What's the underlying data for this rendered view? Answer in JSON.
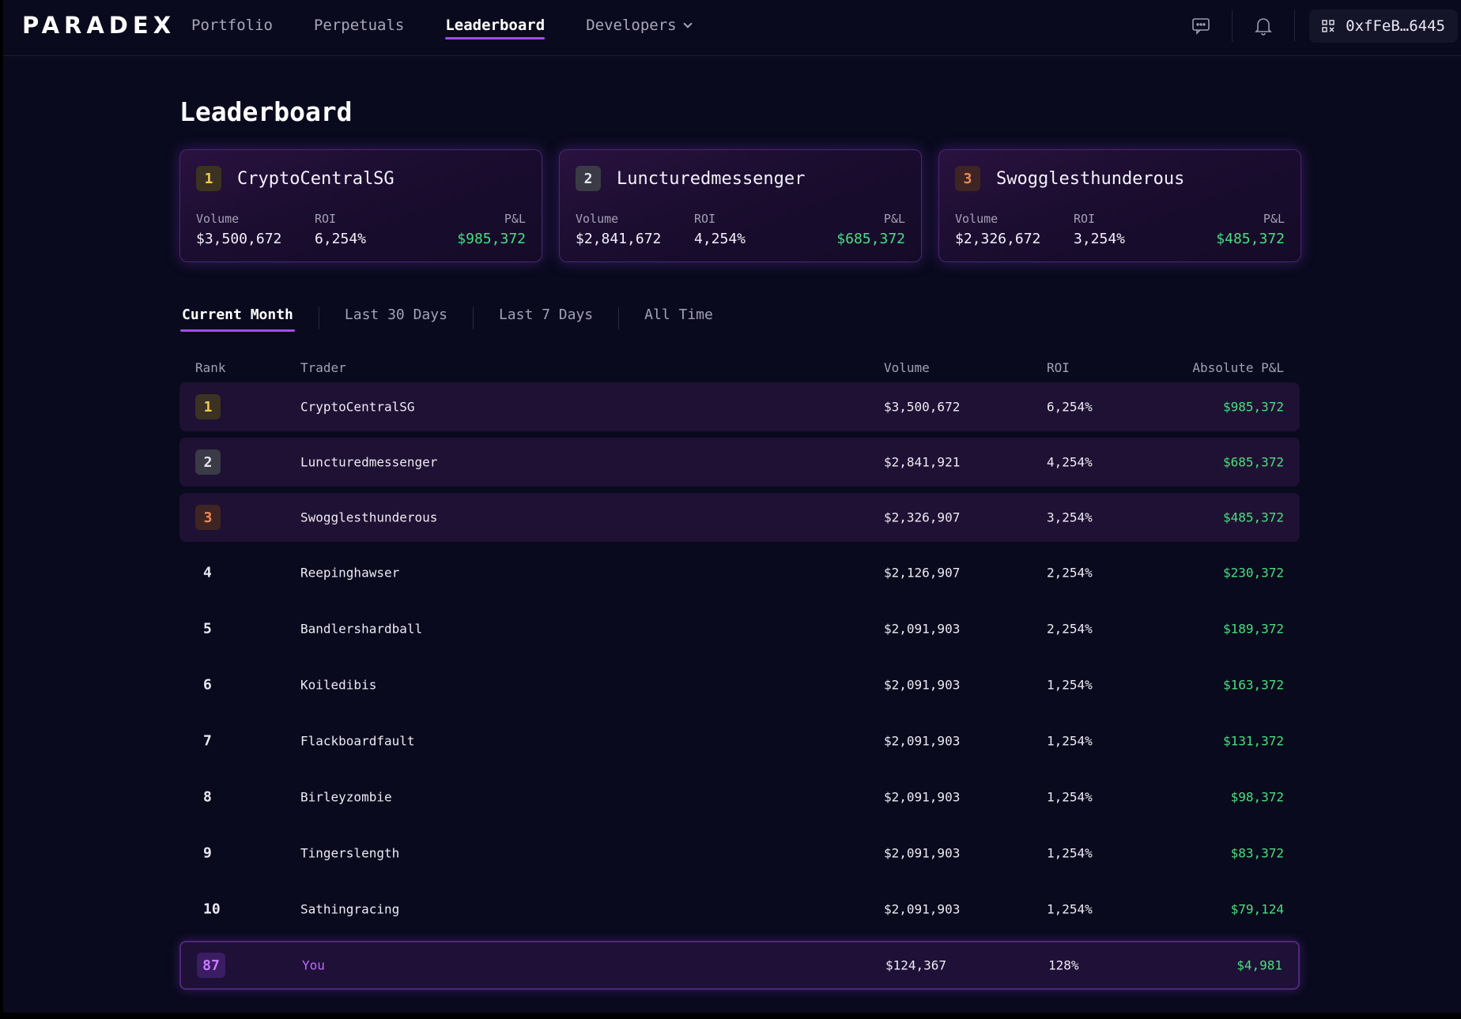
{
  "brand": {
    "logo_text": "PARADEX"
  },
  "nav": {
    "links": [
      {
        "label": "Portfolio",
        "active": false
      },
      {
        "label": "Perpetuals",
        "active": false
      },
      {
        "label": "Leaderboard",
        "active": true
      },
      {
        "label": "Developers",
        "active": false,
        "has_dropdown": true
      }
    ],
    "icons": [
      "chat-icon",
      "bell-icon",
      "wallet-icon"
    ],
    "wallet_address": "0xfFeB…6445"
  },
  "page": {
    "title": "Leaderboard"
  },
  "podium": [
    {
      "rank": "1",
      "name": "CryptoCentralSG",
      "volume_label": "Volume",
      "roi_label": "ROI",
      "pnl_label": "P&L",
      "volume": "$3,500,672",
      "roi": "6,254%",
      "pnl": "$985,372"
    },
    {
      "rank": "2",
      "name": "Luncturedmessenger",
      "volume_label": "Volume",
      "roi_label": "ROI",
      "pnl_label": "P&L",
      "volume": "$2,841,672",
      "roi": "4,254%",
      "pnl": "$685,372"
    },
    {
      "rank": "3",
      "name": "Swogglesthunderous",
      "volume_label": "Volume",
      "roi_label": "ROI",
      "pnl_label": "P&L",
      "volume": "$2,326,672",
      "roi": "3,254%",
      "pnl": "$485,372"
    }
  ],
  "tabs": [
    {
      "label": "Current Month",
      "active": true
    },
    {
      "label": "Last 30 Days",
      "active": false
    },
    {
      "label": "Last 7 Days",
      "active": false
    },
    {
      "label": "All Time",
      "active": false
    }
  ],
  "table": {
    "columns": {
      "rank": "Rank",
      "trader": "Trader",
      "volume": "Volume",
      "roi": "ROI",
      "pnl": "Absolute P&L"
    },
    "rows": [
      {
        "rank": "1",
        "trader": "CryptoCentralSG",
        "volume": "$3,500,672",
        "roi": "6,254%",
        "pnl": "$985,372"
      },
      {
        "rank": "2",
        "trader": "Luncturedmessenger",
        "volume": "$2,841,921",
        "roi": "4,254%",
        "pnl": "$685,372"
      },
      {
        "rank": "3",
        "trader": "Swogglesthunderous",
        "volume": "$2,326,907",
        "roi": "3,254%",
        "pnl": "$485,372"
      },
      {
        "rank": "4",
        "trader": "Reepinghawser",
        "volume": "$2,126,907",
        "roi": "2,254%",
        "pnl": "$230,372"
      },
      {
        "rank": "5",
        "trader": "Bandlershardball",
        "volume": "$2,091,903",
        "roi": "2,254%",
        "pnl": "$189,372"
      },
      {
        "rank": "6",
        "trader": "Koiledibis",
        "volume": "$2,091,903",
        "roi": "1,254%",
        "pnl": "$163,372"
      },
      {
        "rank": "7",
        "trader": "Flackboardfault",
        "volume": "$2,091,903",
        "roi": "1,254%",
        "pnl": "$131,372"
      },
      {
        "rank": "8",
        "trader": "Birleyzombie",
        "volume": "$2,091,903",
        "roi": "1,254%",
        "pnl": "$98,372"
      },
      {
        "rank": "9",
        "trader": "Tingerslength",
        "volume": "$2,091,903",
        "roi": "1,254%",
        "pnl": "$83,372"
      },
      {
        "rank": "10",
        "trader": "Sathingracing",
        "volume": "$2,091,903",
        "roi": "1,254%",
        "pnl": "$79,124"
      }
    ],
    "you_row": {
      "rank": "87",
      "trader": "You",
      "volume": "$124,367",
      "roi": "128%",
      "pnl": "$4,981"
    }
  },
  "colors": {
    "accent": "#a24bff",
    "positive": "#4ade80",
    "gold": "#f0c85b",
    "silver": "#e4e4ea",
    "bronze": "#ef8a5a",
    "background": "#090a1d"
  }
}
